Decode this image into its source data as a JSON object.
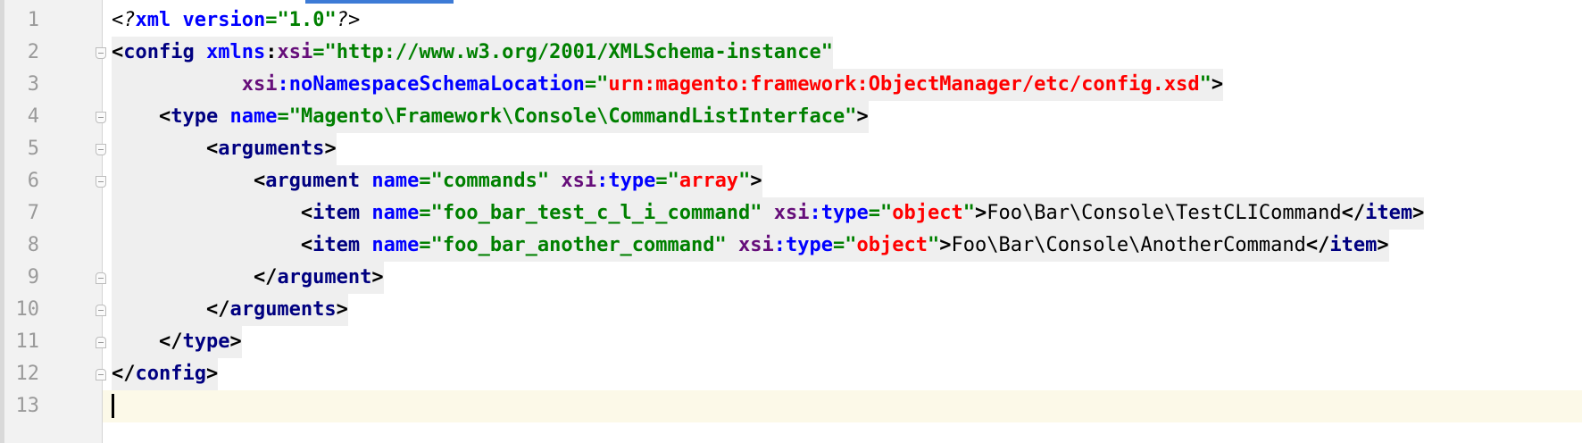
{
  "editor": {
    "line_numbers": [
      "1",
      "2",
      "3",
      "4",
      "5",
      "6",
      "7",
      "8",
      "9",
      "10",
      "11",
      "12",
      "13"
    ],
    "lines": [
      [
        {
          "t": "<?",
          "c": "pi"
        },
        {
          "t": "xml",
          "c": "attr"
        },
        {
          "t": " ",
          "c": ""
        },
        {
          "t": "version",
          "c": "attr"
        },
        {
          "t": "=\"1.0\"",
          "c": "val"
        },
        {
          "t": "?>",
          "c": "pi"
        }
      ],
      [
        {
          "t": "<",
          "c": "b"
        },
        {
          "t": "config",
          "c": "tag"
        },
        {
          "t": " ",
          "c": ""
        },
        {
          "t": "xmlns",
          "c": "attr"
        },
        {
          "t": ":",
          "c": "b"
        },
        {
          "t": "xsi",
          "c": "ns"
        },
        {
          "t": "=\"http://www.w3.org/2001/XMLSchema-instance\"",
          "c": "val"
        }
      ],
      [
        {
          "t": "           ",
          "c": ""
        },
        {
          "t": "xsi",
          "c": "ns"
        },
        {
          "t": ":noNamespaceSchemaLocation",
          "c": "attr"
        },
        {
          "t": "=\"",
          "c": "val"
        },
        {
          "t": "urn:magento:framework:ObjectManager/etc/config.xsd",
          "c": "valr"
        },
        {
          "t": "\"",
          "c": "val"
        },
        {
          "t": ">",
          "c": "b"
        }
      ],
      [
        {
          "t": "    <",
          "c": "b"
        },
        {
          "t": "type",
          "c": "tag"
        },
        {
          "t": " ",
          "c": ""
        },
        {
          "t": "name",
          "c": "attr"
        },
        {
          "t": "=\"Magento\\Framework\\Console\\CommandListInterface\"",
          "c": "val"
        },
        {
          "t": ">",
          "c": "b"
        }
      ],
      [
        {
          "t": "        <",
          "c": "b"
        },
        {
          "t": "arguments",
          "c": "tag"
        },
        {
          "t": ">",
          "c": "b"
        }
      ],
      [
        {
          "t": "            <",
          "c": "b"
        },
        {
          "t": "argument",
          "c": "tag"
        },
        {
          "t": " ",
          "c": ""
        },
        {
          "t": "name",
          "c": "attr"
        },
        {
          "t": "=\"commands\"",
          "c": "val"
        },
        {
          "t": " ",
          "c": ""
        },
        {
          "t": "xsi",
          "c": "ns"
        },
        {
          "t": ":type",
          "c": "attr"
        },
        {
          "t": "=\"",
          "c": "val"
        },
        {
          "t": "array",
          "c": "valr"
        },
        {
          "t": "\"",
          "c": "val"
        },
        {
          "t": ">",
          "c": "b"
        }
      ],
      [
        {
          "t": "                <",
          "c": "b"
        },
        {
          "t": "item",
          "c": "tag"
        },
        {
          "t": " ",
          "c": ""
        },
        {
          "t": "name",
          "c": "attr"
        },
        {
          "t": "=\"foo_bar_test_c_l_i_command\"",
          "c": "val"
        },
        {
          "t": " ",
          "c": ""
        },
        {
          "t": "xsi",
          "c": "ns"
        },
        {
          "t": ":type",
          "c": "attr"
        },
        {
          "t": "=\"",
          "c": "val"
        },
        {
          "t": "object",
          "c": "valr"
        },
        {
          "t": "\"",
          "c": "val"
        },
        {
          "t": ">",
          "c": "b"
        },
        {
          "t": "Foo\\Bar\\Console\\TestCLICommand",
          "c": ""
        },
        {
          "t": "</",
          "c": "b"
        },
        {
          "t": "item",
          "c": "tag"
        },
        {
          "t": ">",
          "c": "b"
        }
      ],
      [
        {
          "t": "                <",
          "c": "b"
        },
        {
          "t": "item",
          "c": "tag"
        },
        {
          "t": " ",
          "c": ""
        },
        {
          "t": "name",
          "c": "attr"
        },
        {
          "t": "=\"foo_bar_another_command\"",
          "c": "val"
        },
        {
          "t": " ",
          "c": ""
        },
        {
          "t": "xsi",
          "c": "ns"
        },
        {
          "t": ":type",
          "c": "attr"
        },
        {
          "t": "=\"",
          "c": "val"
        },
        {
          "t": "object",
          "c": "valr"
        },
        {
          "t": "\"",
          "c": "val"
        },
        {
          "t": ">",
          "c": "b"
        },
        {
          "t": "Foo\\Bar\\Console\\AnotherCommand",
          "c": ""
        },
        {
          "t": "</",
          "c": "b"
        },
        {
          "t": "item",
          "c": "tag"
        },
        {
          "t": ">",
          "c": "b"
        }
      ],
      [
        {
          "t": "            </",
          "c": "b"
        },
        {
          "t": "argument",
          "c": "tag"
        },
        {
          "t": ">",
          "c": "b"
        }
      ],
      [
        {
          "t": "        </",
          "c": "b"
        },
        {
          "t": "arguments",
          "c": "tag"
        },
        {
          "t": ">",
          "c": "b"
        }
      ],
      [
        {
          "t": "    </",
          "c": "b"
        },
        {
          "t": "type",
          "c": "tag"
        },
        {
          "t": ">",
          "c": "b"
        }
      ],
      [
        {
          "t": "</",
          "c": "b"
        },
        {
          "t": "config",
          "c": "tag"
        },
        {
          "t": ">",
          "c": "b"
        }
      ],
      []
    ],
    "current_line": 13,
    "highlight_line_1": false
  }
}
